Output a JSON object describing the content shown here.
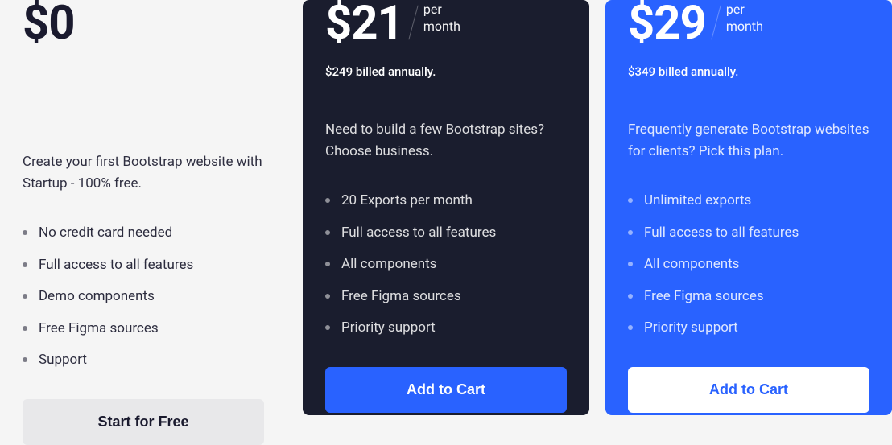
{
  "plans": [
    {
      "price": "$0",
      "per_month": "",
      "billed_annually": "",
      "description": "Create your first Bootstrap website with Startup - 100% free.",
      "features": [
        "No credit card needed",
        "Full access to all features",
        "Demo components",
        "Free Figma sources",
        "Support"
      ],
      "cta": "Start for Free"
    },
    {
      "price": "$21",
      "per_month_1": "per",
      "per_month_2": "month",
      "billed_annually": "$249 billed annually.",
      "description": "Need to build a few Bootstrap sites? Choose business.",
      "features": [
        "20 Exports per month",
        "Full access to all features",
        "All components",
        "Free Figma sources",
        "Priority support"
      ],
      "cta": "Add to Cart"
    },
    {
      "price": "$29",
      "per_month_1": "per",
      "per_month_2": "month",
      "billed_annually": "$349 billed annually.",
      "description": "Frequently generate Bootstrap websites for clients? Pick this plan.",
      "features": [
        "Unlimited exports",
        "Full access to all features",
        "All components",
        "Free Figma sources",
        "Priority support"
      ],
      "cta": "Add to Cart"
    }
  ]
}
